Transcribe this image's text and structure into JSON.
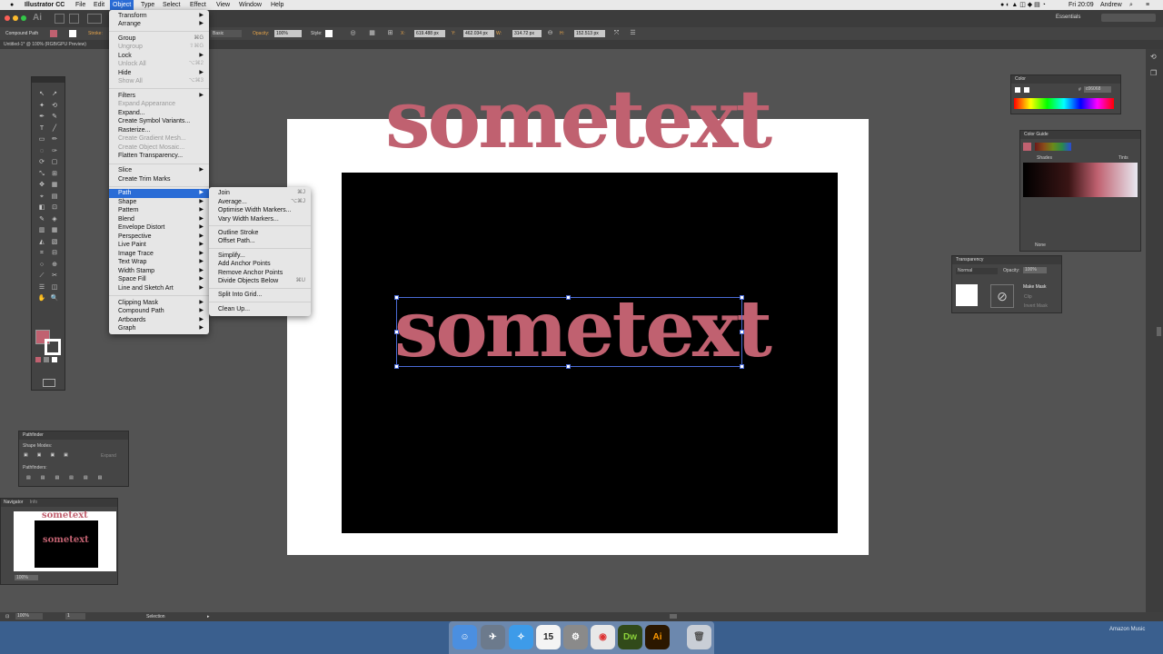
{
  "menubar": {
    "app_name": "Illustrator CC",
    "items": [
      "File",
      "Edit",
      "Object",
      "Type",
      "Select",
      "Effect",
      "View",
      "Window",
      "Help"
    ],
    "active_item": "Object",
    "clock": "Fri 20:09",
    "user": "Andrew",
    "workspace": "Essentials"
  },
  "controlbar": {
    "selection_type": "Compound Path",
    "stroke_label": "Stroke:",
    "stroke_style": "Basic",
    "opacity_label": "Opacity:",
    "opacity_value": "100%",
    "style_label": "Style:",
    "x_label": "X:",
    "x_value": "619.488 px",
    "y_label": "Y:",
    "y_value": "462.034 px",
    "w_label": "W:",
    "w_value": "314.72 px",
    "h_label": "H:",
    "h_value": "152.513 px"
  },
  "document_tab": "Untitled-1* @ 100% (RGB/GPU Preview)",
  "object_menu": {
    "items": [
      {
        "label": "Transform",
        "submenu": true
      },
      {
        "label": "Arrange",
        "submenu": true
      },
      {
        "sep": true
      },
      {
        "label": "Group",
        "shortcut": "⌘G"
      },
      {
        "label": "Ungroup",
        "shortcut": "⇧⌘G",
        "disabled": true
      },
      {
        "label": "Lock",
        "submenu": true
      },
      {
        "label": "Unlock All",
        "shortcut": "⌥⌘2",
        "disabled": true
      },
      {
        "label": "Hide",
        "submenu": true
      },
      {
        "label": "Show All",
        "shortcut": "⌥⌘3",
        "disabled": true
      },
      {
        "sep": true
      },
      {
        "label": "Filters",
        "submenu": true
      },
      {
        "label": "Expand Appearance",
        "disabled": true
      },
      {
        "label": "Expand..."
      },
      {
        "label": "Create Symbol Variants..."
      },
      {
        "label": "Rasterize..."
      },
      {
        "label": "Create Gradient Mesh...",
        "disabled": true
      },
      {
        "label": "Create Object Mosaic...",
        "disabled": true
      },
      {
        "label": "Flatten Transparency..."
      },
      {
        "sep": true
      },
      {
        "label": "Slice",
        "submenu": true
      },
      {
        "label": "Create Trim Marks"
      },
      {
        "sep": true
      },
      {
        "label": "Path",
        "submenu": true,
        "highlight": true
      },
      {
        "label": "Shape",
        "submenu": true
      },
      {
        "label": "Pattern",
        "submenu": true
      },
      {
        "label": "Blend",
        "submenu": true
      },
      {
        "label": "Envelope Distort",
        "submenu": true
      },
      {
        "label": "Perspective",
        "submenu": true
      },
      {
        "label": "Live Paint",
        "submenu": true
      },
      {
        "label": "Image Trace",
        "submenu": true
      },
      {
        "label": "Text Wrap",
        "submenu": true
      },
      {
        "label": "Width Stamp",
        "submenu": true
      },
      {
        "label": "Space Fill",
        "submenu": true
      },
      {
        "label": "Line and Sketch Art",
        "submenu": true
      },
      {
        "sep": true
      },
      {
        "label": "Clipping Mask",
        "submenu": true
      },
      {
        "label": "Compound Path",
        "submenu": true
      },
      {
        "label": "Artboards",
        "submenu": true
      },
      {
        "label": "Graph",
        "submenu": true
      }
    ]
  },
  "path_submenu": {
    "items": [
      {
        "label": "Join",
        "shortcut": "⌘J"
      },
      {
        "label": "Average...",
        "shortcut": "⌥⌘J"
      },
      {
        "label": "Optimise Width Markers..."
      },
      {
        "label": "Vary Width Markers..."
      },
      {
        "sep": true
      },
      {
        "label": "Outline Stroke"
      },
      {
        "label": "Offset Path..."
      },
      {
        "sep": true
      },
      {
        "label": "Simplify..."
      },
      {
        "label": "Add Anchor Points"
      },
      {
        "label": "Remove Anchor Points"
      },
      {
        "label": "Divide Objects Below",
        "shortcut": "⌘U"
      },
      {
        "sep": true
      },
      {
        "label": "Split Into Grid..."
      },
      {
        "sep": true
      },
      {
        "label": "Clean Up..."
      }
    ]
  },
  "canvas": {
    "top_text": "sometext",
    "selected_text": "sometext"
  },
  "color_panel": {
    "title": "Color",
    "hex": "c06068"
  },
  "color_guide": {
    "title": "Color Guide",
    "shades_label": "Shades",
    "tints_label": "Tints",
    "none_label": "None"
  },
  "transparency": {
    "title": "Transparency",
    "blend_mode": "Normal",
    "opacity_label": "Opacity:",
    "opacity_value": "100%",
    "make_mask": "Make Mask",
    "clip": "Clip",
    "invert_mask": "Invert Mask"
  },
  "pathfinder": {
    "title": "Pathfinder",
    "shape_modes": "Shape Modes:",
    "expand": "Expand",
    "pathfinders": "Pathfinders:"
  },
  "navigator": {
    "tab1": "Navigator",
    "tab2": "Info",
    "zoom": "100%",
    "thumb_text": "sometext"
  },
  "statusbar": {
    "zoom": "100%",
    "page": "1",
    "tool": "Selection"
  },
  "dock": {
    "calendar_day": "15",
    "dw_label": "Dw",
    "ai_label": "Ai",
    "now_playing": "Amazon Music"
  },
  "colors": {
    "accent": "#2a6cd6",
    "text_fill": "#c06170",
    "artboard": "#ffffff",
    "rect": "#000000"
  }
}
